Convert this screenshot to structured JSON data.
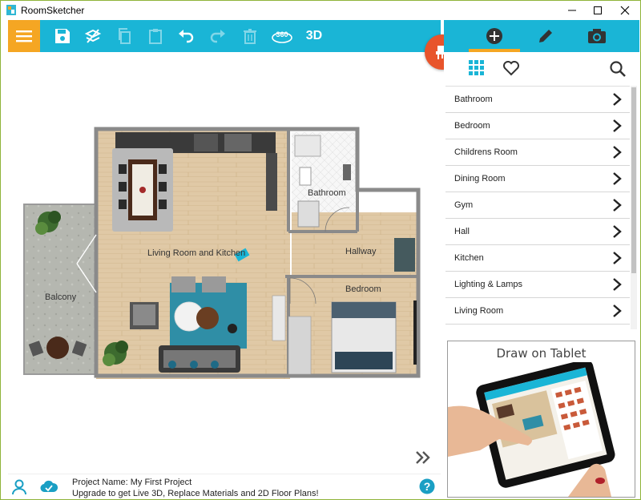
{
  "window": {
    "title": "RoomSketcher"
  },
  "toolbar": {
    "view_3d_label": "3D",
    "view_360_label": "360"
  },
  "plan": {
    "rooms": {
      "living": "Living Room and Kitchen",
      "bathroom": "Bathroom",
      "hallway": "Hallway",
      "bedroom": "Bedroom",
      "balcony": "Balcony"
    }
  },
  "catalog": {
    "items": [
      {
        "label": "Bathroom"
      },
      {
        "label": "Bedroom"
      },
      {
        "label": "Childrens Room"
      },
      {
        "label": "Dining Room"
      },
      {
        "label": "Gym"
      },
      {
        "label": "Hall"
      },
      {
        "label": "Kitchen"
      },
      {
        "label": "Lighting & Lamps"
      },
      {
        "label": "Living Room"
      }
    ]
  },
  "promo": {
    "title": "Draw on Tablet"
  },
  "status": {
    "project_name": "Project Name: My First Project",
    "upgrade_message": "Upgrade to get Live 3D, Replace Materials and 2D Floor Plans!"
  },
  "colors": {
    "accent_blue": "#1ab5d6",
    "accent_orange": "#f5a623",
    "badge_red": "#e8542b"
  }
}
